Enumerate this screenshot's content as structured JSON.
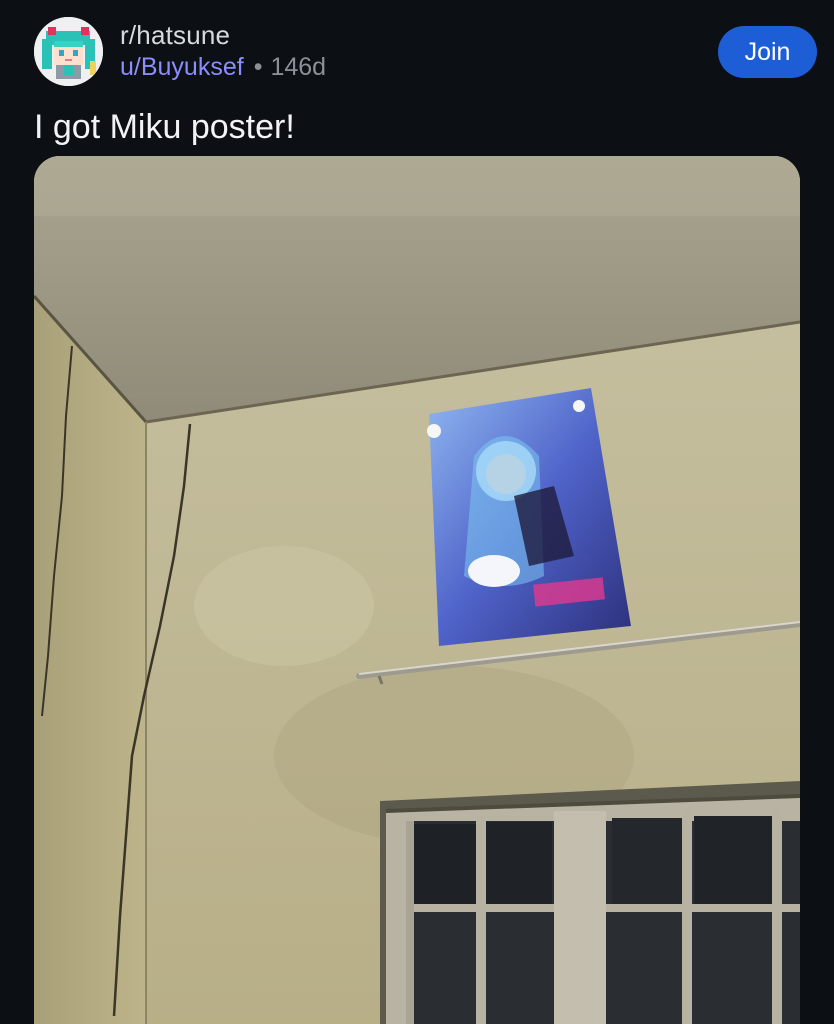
{
  "post": {
    "subreddit": "r/hatsune",
    "username": "u/Buyuksef",
    "separator": "•",
    "age": "146d",
    "join_label": "Join",
    "title": "I got Miku poster!"
  },
  "icons": {
    "avatar": "subreddit-avatar-icon"
  },
  "colors": {
    "background": "#0c0f14",
    "join_button": "#1d5ed6",
    "username": "#8a8dfb",
    "muted": "#8b9096"
  }
}
